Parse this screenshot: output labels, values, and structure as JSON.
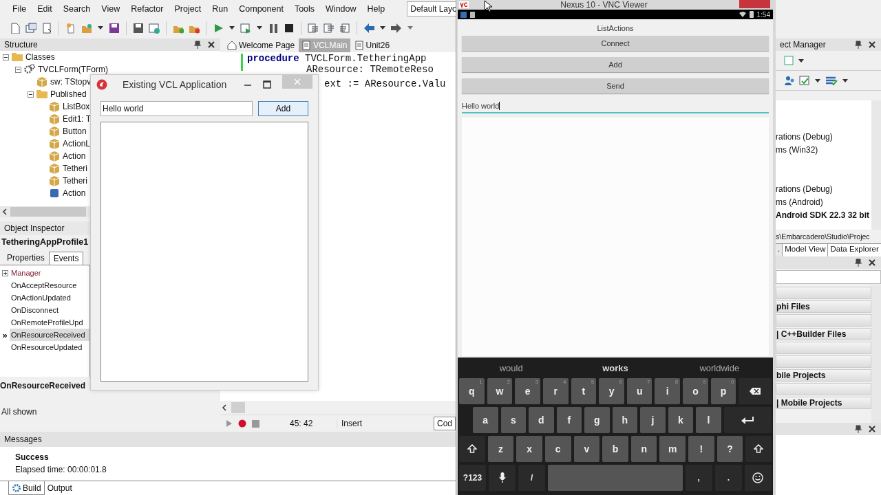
{
  "menu_bar": {
    "items": [
      "File",
      "Edit",
      "Search",
      "View",
      "Refactor",
      "Project",
      "Run",
      "Component",
      "Tools",
      "Window",
      "Help"
    ]
  },
  "layout_selector": {
    "value": "Default Layo"
  },
  "structure_panel": {
    "title": "Structure",
    "tree": [
      {
        "label": "Classes",
        "kind": "folder",
        "expanded": true,
        "children": [
          {
            "label": "TVCLForm(TForm)",
            "kind": "class",
            "expanded": true,
            "children": [
              {
                "label": "sw: TStopv",
                "kind": "component"
              },
              {
                "label": "Published",
                "kind": "folder",
                "expanded": true,
                "children": [
                  {
                    "label": "ListBox",
                    "kind": "component"
                  },
                  {
                    "label": "Edit1: T",
                    "kind": "component"
                  },
                  {
                    "label": "Button",
                    "kind": "component"
                  },
                  {
                    "label": "ActionL",
                    "kind": "component"
                  },
                  {
                    "label": "Action",
                    "kind": "component"
                  },
                  {
                    "label": "Tetheri",
                    "kind": "component"
                  },
                  {
                    "label": "Tetheri",
                    "kind": "component"
                  },
                  {
                    "label": "Action",
                    "kind": "action"
                  }
                ]
              }
            ]
          }
        ]
      }
    ]
  },
  "object_inspector": {
    "title": "Object Inspector",
    "component": "TetheringAppProfile1",
    "tabs": [
      {
        "label": "Properties",
        "selected": false
      },
      {
        "label": "Events",
        "selected": true
      }
    ],
    "events": [
      {
        "name": "Manager",
        "kind": "group",
        "expanded": false,
        "selected": false
      },
      {
        "name": "OnAcceptResource",
        "kind": "event",
        "selected": false
      },
      {
        "name": "OnActionUpdated",
        "kind": "event",
        "selected": false
      },
      {
        "name": "OnDisconnect",
        "kind": "event",
        "selected": false
      },
      {
        "name": "OnRemoteProfileUpd",
        "kind": "event",
        "selected": false
      },
      {
        "name": "OnResourceReceived",
        "kind": "event",
        "selected": true
      },
      {
        "name": "OnResourceUpdated",
        "kind": "event",
        "selected": false
      }
    ],
    "selected_marker": "»",
    "description": "OnResourceReceived",
    "filter": "All shown"
  },
  "editor": {
    "tabs": [
      {
        "label": "Welcome Page",
        "kind": "home",
        "selected": false
      },
      {
        "label": "VCLMain",
        "kind": "unit",
        "selected": true
      },
      {
        "label": "Unit26",
        "kind": "unit",
        "selected": false
      }
    ],
    "code_lines": [
      {
        "kind": "header",
        "keyword": "procedure",
        "text": "TVCLForm.TetheringApp"
      },
      {
        "kind": "param",
        "text": "AResource: TRemoteReso"
      },
      {
        "kind": "body",
        "text": "ext := AResource.Valu"
      }
    ],
    "position": "45: 42",
    "mode": "Insert",
    "view_tab": "Cod"
  },
  "project_manager": {
    "title": "ect Manager",
    "items": [
      {
        "text": "rations (Debug)",
        "bold": false
      },
      {
        "text": "ms (Win32)",
        "bold": false
      },
      {
        "text": "rations (Debug)",
        "bold": false
      },
      {
        "text": "ms (Android)",
        "bold": false
      },
      {
        "text": "Android SDK 22.3 32 bit",
        "bold": true
      }
    ],
    "path": "s\\Embarcadero\\Studio\\Projec",
    "tabs": [
      {
        "label": ".",
        "selected": true
      },
      {
        "label": "Model View",
        "selected": false
      },
      {
        "label": "Data Explorer",
        "selected": false
      }
    ]
  },
  "tool_palette": {
    "items": [
      {
        "kind": "blank"
      },
      {
        "kind": "category",
        "text": "phi Files"
      },
      {
        "kind": "blank"
      },
      {
        "kind": "category",
        "text": "| C++Builder Files"
      },
      {
        "kind": "blank"
      },
      {
        "kind": "blank"
      },
      {
        "kind": "category",
        "text": "bile Projects"
      },
      {
        "kind": "blank"
      },
      {
        "kind": "category",
        "text": "| Mobile Projects"
      }
    ]
  },
  "messages": {
    "title": "Messages",
    "lines": [
      {
        "text": "Success",
        "bold": true
      },
      {
        "text": "Elapsed time: 00:00:01.8",
        "bold": false
      }
    ],
    "tabs": [
      {
        "label": "Build",
        "selected": true
      },
      {
        "label": "Output",
        "selected": false
      }
    ]
  },
  "vcl_window": {
    "title": "Existing VCL Application",
    "edit_value": "Hello world",
    "button": "Add"
  },
  "vnc_window": {
    "title": "Nexus 10 - VNC Viewer",
    "device_time": "1:54",
    "app_title": "ListActions",
    "buttons": [
      "Connect",
      "Add",
      "Send"
    ],
    "edit_value": "Hello world",
    "keyboard": {
      "suggestions": [
        {
          "text": "would",
          "selected": false
        },
        {
          "text": "works",
          "selected": true
        },
        {
          "text": "worldwide",
          "selected": false
        }
      ],
      "rows": [
        {
          "keys": [
            {
              "kind": "letter",
              "label": "q",
              "hint": "1"
            },
            {
              "kind": "letter",
              "label": "w",
              "hint": "2"
            },
            {
              "kind": "letter",
              "label": "e",
              "hint": "3"
            },
            {
              "kind": "letter",
              "label": "r",
              "hint": "4"
            },
            {
              "kind": "letter",
              "label": "t",
              "hint": "5"
            },
            {
              "kind": "letter",
              "label": "y",
              "hint": "6"
            },
            {
              "kind": "letter",
              "label": "u",
              "hint": "7"
            },
            {
              "kind": "letter",
              "label": "i",
              "hint": "8"
            },
            {
              "kind": "letter",
              "label": "o",
              "hint": "9"
            },
            {
              "kind": "letter",
              "label": "p",
              "hint": "0"
            },
            {
              "kind": "backspace"
            }
          ]
        },
        {
          "keys": [
            {
              "kind": "letter",
              "label": "a"
            },
            {
              "kind": "letter",
              "label": "s"
            },
            {
              "kind": "letter",
              "label": "d"
            },
            {
              "kind": "letter",
              "label": "f"
            },
            {
              "kind": "letter",
              "label": "g"
            },
            {
              "kind": "letter",
              "label": "h"
            },
            {
              "kind": "letter",
              "label": "j"
            },
            {
              "kind": "letter",
              "label": "k"
            },
            {
              "kind": "letter",
              "label": "l"
            },
            {
              "kind": "enter"
            }
          ]
        },
        {
          "keys": [
            {
              "kind": "shift"
            },
            {
              "kind": "letter",
              "label": "z"
            },
            {
              "kind": "letter",
              "label": "x"
            },
            {
              "kind": "letter",
              "label": "c"
            },
            {
              "kind": "letter",
              "label": "v"
            },
            {
              "kind": "letter",
              "label": "b"
            },
            {
              "kind": "letter",
              "label": "n"
            },
            {
              "kind": "letter",
              "label": "m"
            },
            {
              "kind": "letter",
              "label": "!"
            },
            {
              "kind": "letter",
              "label": "?"
            },
            {
              "kind": "shift"
            }
          ]
        },
        {
          "keys": [
            {
              "kind": "func",
              "label": "?123"
            },
            {
              "kind": "mic"
            },
            {
              "kind": "func",
              "label": "/"
            },
            {
              "kind": "space"
            },
            {
              "kind": "func",
              "label": ","
            },
            {
              "kind": "func",
              "label": "."
            },
            {
              "kind": "emoji"
            }
          ]
        }
      ]
    }
  }
}
